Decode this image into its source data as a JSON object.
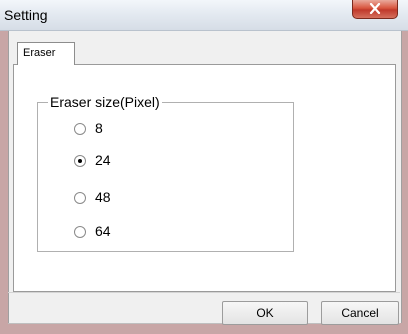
{
  "window": {
    "title": "Setting"
  },
  "tabs": [
    {
      "label": "Eraser",
      "active": true
    }
  ],
  "group": {
    "title": "Eraser size(Pixel)",
    "options": [
      {
        "label": "8",
        "selected": false
      },
      {
        "label": "24",
        "selected": true
      },
      {
        "label": "48",
        "selected": false
      },
      {
        "label": "64",
        "selected": false
      }
    ]
  },
  "buttons": {
    "ok": "OK",
    "cancel": "Cancel"
  }
}
